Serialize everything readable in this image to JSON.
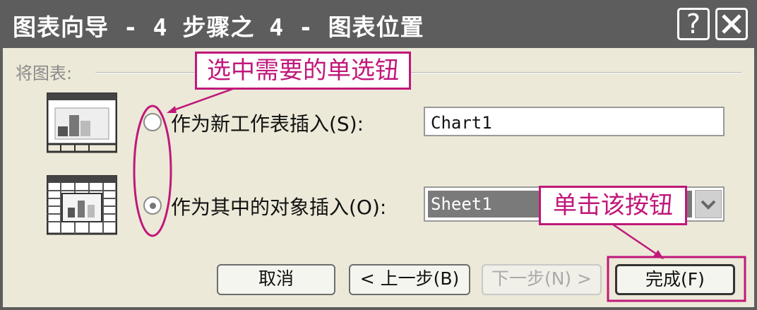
{
  "window": {
    "title": "图表向导 - 4 步骤之 4 - 图表位置",
    "help_label": "?"
  },
  "group": {
    "label": "将图表:"
  },
  "options": [
    {
      "label": "作为新工作表插入(S):",
      "value": "Chart1",
      "selected": false
    },
    {
      "label": "作为其中的对象插入(O):",
      "value": "Sheet1",
      "selected": true
    }
  ],
  "buttons": {
    "cancel": "取消",
    "back": "< 上一步(B)",
    "next": "下一步(N) >",
    "finish": "完成(F)"
  },
  "annotations": {
    "radio_hint": "选中需要的单选钮",
    "finish_hint": "单击该按钮",
    "color": "#c0187a"
  }
}
